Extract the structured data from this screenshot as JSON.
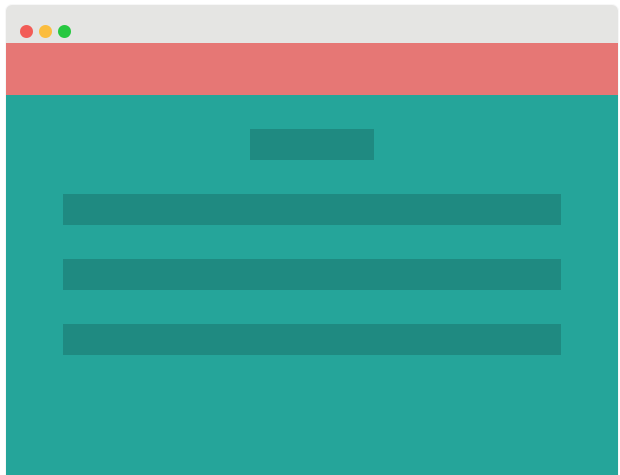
{
  "window": {
    "controls": {
      "close_color": "#f25c57",
      "minimize_color": "#fbbd3e",
      "maximize_color": "#27c840"
    },
    "chrome_color": "#e5e5e3"
  },
  "header": {
    "color": "#e67775"
  },
  "main": {
    "background_color": "#25a59a",
    "placeholder_color": "#1f8a81",
    "title_placeholder": "",
    "text_lines": [
      "",
      "",
      ""
    ]
  }
}
